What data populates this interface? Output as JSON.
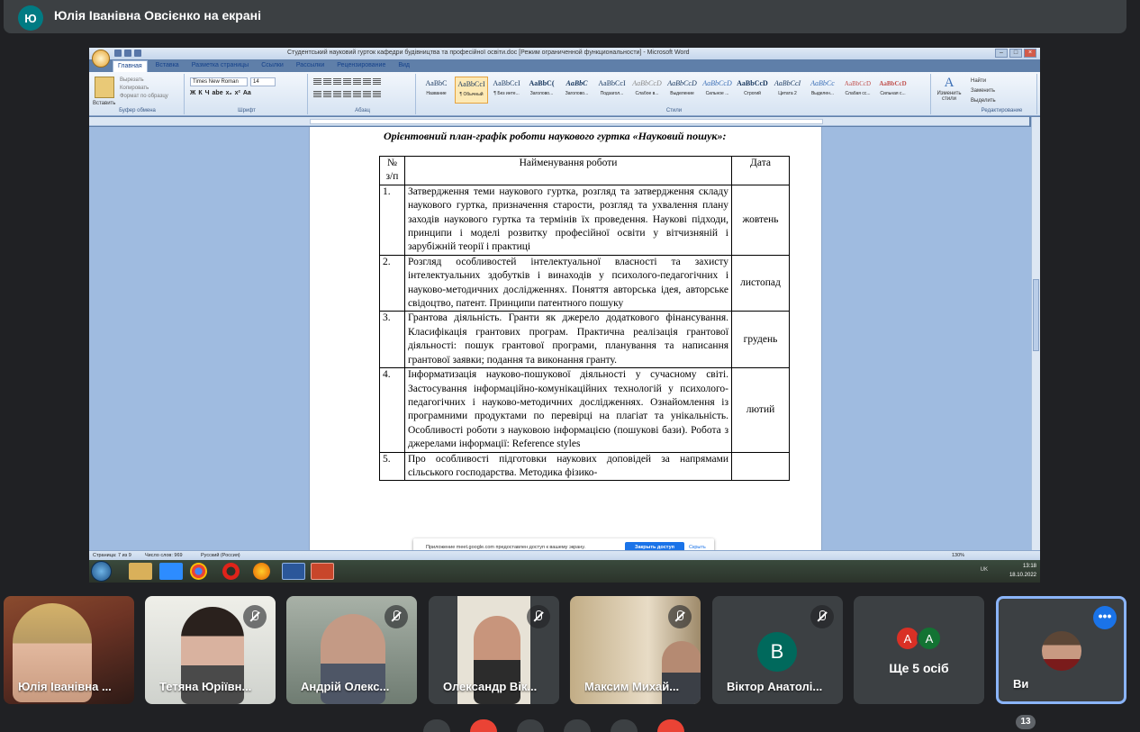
{
  "presenter": {
    "initial": "Ю",
    "title": "Юлія Іванівна Овсієнко на екрані"
  },
  "word": {
    "window_title": "Студентський науковий гурток кафедри будівництва та професійної освіти.doc [Режим ограниченной функциональности] - Microsoft Word",
    "tabs": [
      "Главная",
      "Вставка",
      "Разметка страницы",
      "Ссылки",
      "Рассылки",
      "Рецензирование",
      "Вид"
    ],
    "clipboard": {
      "paste": "Вставить",
      "items": [
        "Вырезать",
        "Копировать",
        "Формат по образцу"
      ],
      "label": "Буфер обмена"
    },
    "font": {
      "name": "Times New Roman",
      "size": "14",
      "label": "Шрифт",
      "format_buttons": [
        "Ж",
        "К",
        "Ч",
        "abe",
        "x₂",
        "x²",
        "Aa"
      ]
    },
    "paragraph_label": "Абзац",
    "styles": [
      {
        "sample": "AaBbC",
        "name": "Название"
      },
      {
        "sample": "AaBbCcI",
        "name": "¶ Обычный"
      },
      {
        "sample": "AaBbCcI",
        "name": "¶ Без инте..."
      },
      {
        "sample": "AaBbC(",
        "name": "Заголово..."
      },
      {
        "sample": "AaBbC",
        "name": "Заголово..."
      },
      {
        "sample": "AaBbCcI",
        "name": "Подзагол..."
      },
      {
        "sample": "AaBbCcD",
        "name": "Слабое в..."
      },
      {
        "sample": "AaBbCcD",
        "name": "Выделение"
      },
      {
        "sample": "AaBbCcD",
        "name": "Сильное ..."
      },
      {
        "sample": "AaBbCcD",
        "name": "Строгий"
      },
      {
        "sample": "AaBbCcI",
        "name": "Цитата 2"
      },
      {
        "sample": "AaBbCc",
        "name": "Выделен..."
      },
      {
        "sample": "AaBbCcD",
        "name": "Слабая сс..."
      },
      {
        "sample": "AaBbCcD",
        "name": "Сильная с..."
      }
    ],
    "styles_label": "Стили",
    "change_styles": "Изменить стили",
    "editing": {
      "items": [
        "Найти",
        "Заменить",
        "Выделить"
      ],
      "label": "Редактирование"
    },
    "status": {
      "page": "Страница: 7 из 9",
      "words": "Число слов: 969",
      "lang": "Русский (Россия)",
      "zoom": "130%"
    }
  },
  "document": {
    "heading": "Орієнтовний план-графік роботи наукового гуртка «Науковий пошук»:",
    "columns": [
      "№ з/п",
      "Найменування роботи",
      "Дата"
    ],
    "rows": [
      {
        "no": "1.",
        "work": "Затвердження теми наукового гуртка, розгляд та затвердження складу наукового гуртка, призначення старости, розгляд та ухвалення плану заходів наукового гуртка та термінів їх проведення. Наукові підходи, принципи і моделі розвитку професійної освіти у вітчизняній і зарубіжній теорії і практиці",
        "date": "жовтень"
      },
      {
        "no": "2.",
        "work": "Розгляд особливостей інтелектуальної власності та захисту інтелектуальних здобутків і винаходів у психолого-педагогічних і науково-методичних дослідженнях. Поняття авторська ідея, авторське свідоцтво, патент. Принципи патентного пошуку",
        "date": "листопад"
      },
      {
        "no": "3.",
        "work": "Грантова діяльність. Гранти як джерело додаткового фінансування. Класифікація грантових програм. Практична реалізація грантової діяльності: пошук грантової програми, планування та написання грантової заявки; подання та виконання гранту.",
        "date": "грудень"
      },
      {
        "no": "4.",
        "work": "Інформатизація науково-пошукової діяльності у сучасному світі. Застосування інформаційно-комунікаційних технологій у психолого-педагогічних і науково-методичних дослідженнях. Ознайомлення із програмними продуктами по перевірці на плагіат та унікальність. Особливості роботи з науковою інформацією (пошукові бази). Робота з джерелами інформації: Reference styles",
        "date": "лютий"
      },
      {
        "no": "5.",
        "work": "Про особливості підготовки наукових доповідей за напрямами сільського господарства. Методика фізико-",
        "date": ""
      }
    ]
  },
  "share_notice": {
    "message": "Приложение meet.google.com предоставлен доступ к вашему экрану.",
    "stop_label": "Закрыть доступ",
    "hide_label": "Скрыть"
  },
  "taskbar": {
    "lang": "UK",
    "time": "13:18",
    "date": "18.10.2022"
  },
  "participants": [
    {
      "name": "Юлія Іванівна ..."
    },
    {
      "name": "Тетяна Юріївн..."
    },
    {
      "name": "Андрій Олекс..."
    },
    {
      "name": "Олександр Вік..."
    },
    {
      "name": "Максим Михай..."
    },
    {
      "name": "Віктор Анатолі...",
      "initial": "В"
    },
    {
      "name": "Ще 5 осіб",
      "avatars": [
        "А",
        "А"
      ]
    },
    {
      "name": "Ви"
    }
  ],
  "more_options": "•••",
  "participant_count": "13",
  "colors": {
    "accent": "#1a73e8",
    "tile": "#3c4043",
    "background": "#202124",
    "avatar_teal": "#007b83"
  }
}
